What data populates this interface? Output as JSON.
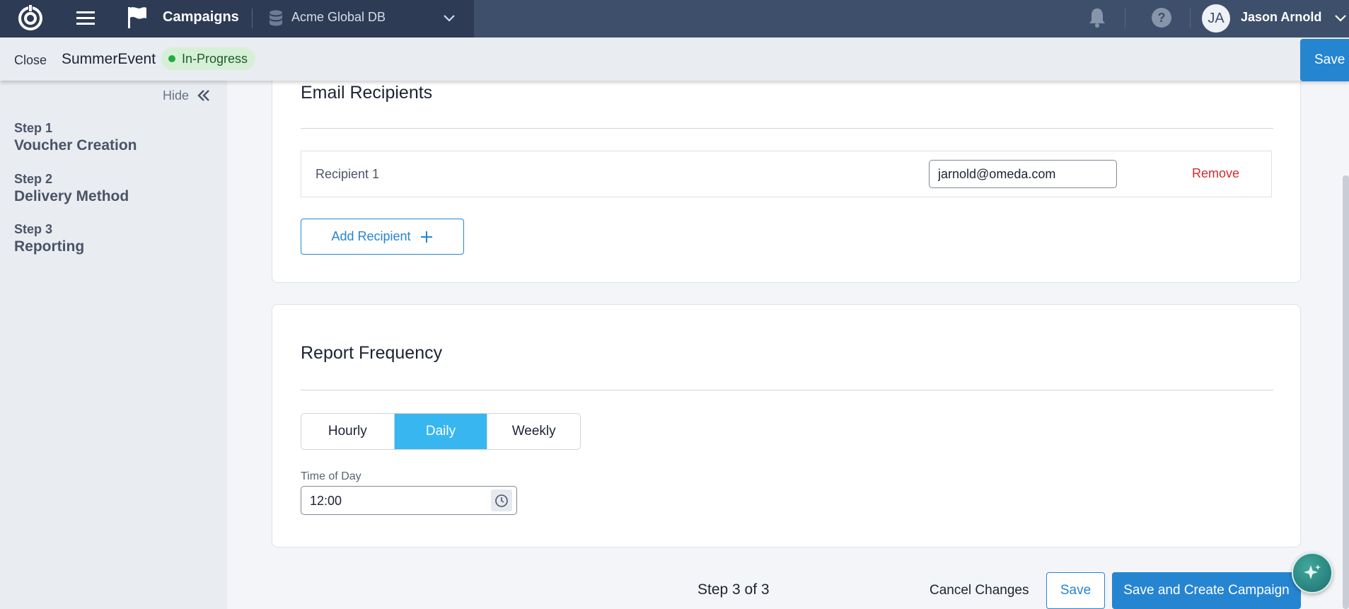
{
  "topbar": {
    "app_title": "Campaigns",
    "database": "Acme Global DB",
    "user_initials": "JA",
    "user_name": "Jason Arnold",
    "colors": {
      "bar": "#3e4f6b",
      "bar_left": "#2d3b55"
    }
  },
  "subheader": {
    "close_label": "Close",
    "campaign_name": "SummerEvent",
    "status": "In-Progress",
    "save_label": "Save"
  },
  "sidebar": {
    "hide_label": "Hide",
    "steps": [
      {
        "number": "Step 1",
        "name": "Voucher Creation"
      },
      {
        "number": "Step 2",
        "name": "Delivery Method"
      },
      {
        "number": "Step 3",
        "name": "Reporting"
      }
    ]
  },
  "email_recipients": {
    "title": "Email Recipients",
    "recipients": [
      {
        "label": "Recipient 1",
        "email": "jarnold@omeda.com",
        "remove_label": "Remove"
      }
    ],
    "add_label": "Add Recipient"
  },
  "report_frequency": {
    "title": "Report Frequency",
    "options": [
      "Hourly",
      "Daily",
      "Weekly"
    ],
    "selected": "Daily",
    "time_label": "Time of Day",
    "time_value": "12:00"
  },
  "footer": {
    "step_count": "Step 3 of 3",
    "cancel_label": "Cancel Changes",
    "save_label": "Save",
    "create_label": "Save and Create Campaign"
  },
  "accent_color": "#2585d1",
  "active_segment_color": "#38b6f0",
  "icons": [
    "logo-icon",
    "menu-icon",
    "flag-icon",
    "database-icon",
    "chevron-down-icon",
    "bell-icon",
    "help-icon",
    "double-chevron-left-icon",
    "plus-icon",
    "clock-icon",
    "sparkle-icon"
  ]
}
